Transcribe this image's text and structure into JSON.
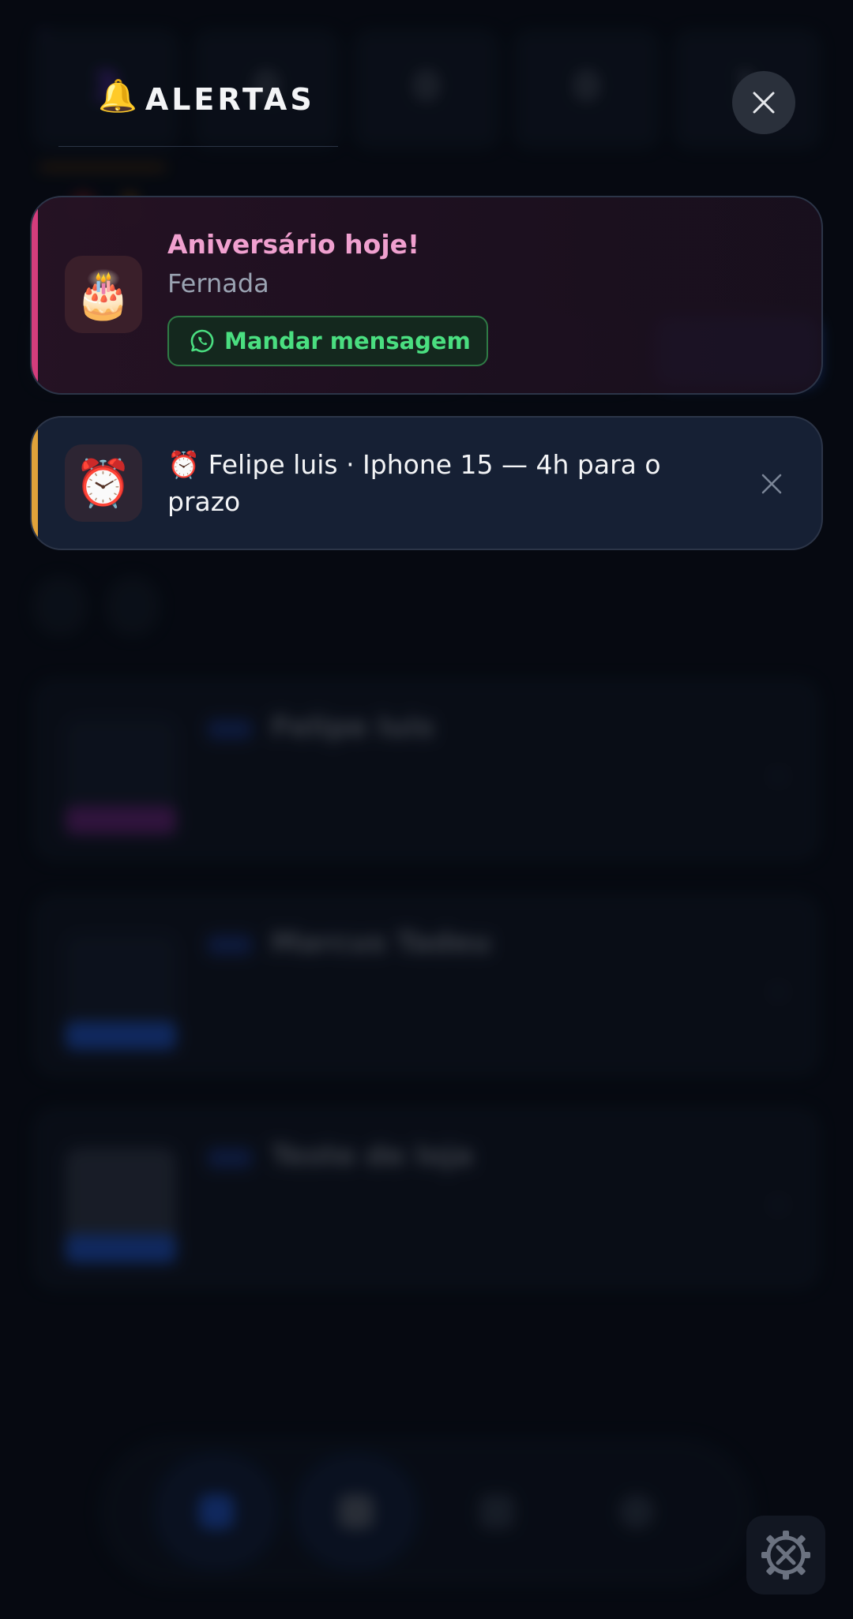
{
  "header": {
    "icon": "bell-icon",
    "bell_glyph": "🔔",
    "title": "ALERTAS"
  },
  "alerts": [
    {
      "type": "birthday",
      "icon": "birthday-cake-icon",
      "icon_glyph": "🎂",
      "title": "Aniversário hoje!",
      "name": "Fernada",
      "action_label": "Mandar mensagem",
      "action_icon": "whatsapp-icon",
      "accent": "#d43d7c"
    },
    {
      "type": "deadline",
      "icon": "alarm-clock-icon",
      "icon_glyph": "⏰",
      "text": "⏰ Felipe luis · Iphone 15 — 4h para o prazo",
      "accent": "#e0a23a"
    }
  ],
  "background": {
    "stats": [
      {
        "value": "3",
        "label": ""
      },
      {
        "value": "0",
        "label": ""
      },
      {
        "value": "0",
        "label": ""
      },
      {
        "value": "0",
        "label": ""
      },
      {
        "value": "1",
        "label": ""
      }
    ],
    "orders": [
      {
        "name": "Felipe luis"
      },
      {
        "name": "Marcus Tadeu"
      },
      {
        "name": "Teste de loja"
      }
    ]
  },
  "colors": {
    "background": "#080c14",
    "birthday_accent": "#d43d7c",
    "deadline_accent": "#e0a23a",
    "whatsapp_green": "#4ade80",
    "primary_blue": "#2f5fe0"
  }
}
